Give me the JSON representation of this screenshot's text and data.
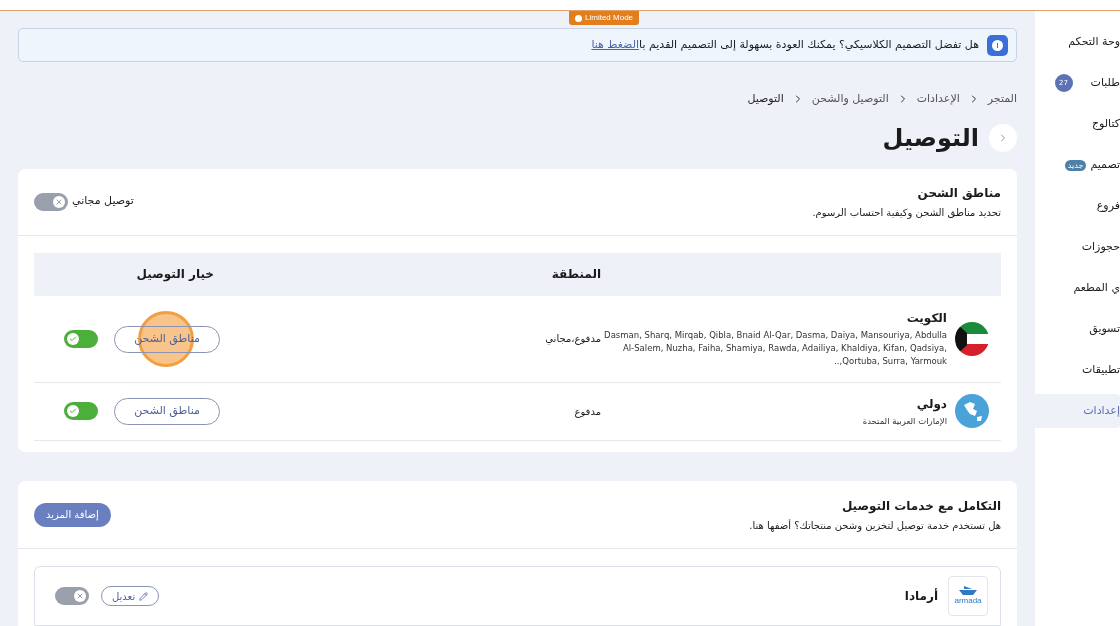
{
  "top_bar": {
    "mode_badge": "Limited Mode"
  },
  "banner": {
    "text": "هل تفضل التصميم الكلاسيكي؟ يمكنك العودة بسهولة إلى التصميم القديم با",
    "link": "الضغط هنا"
  },
  "breadcrumb": [
    "المتجر",
    "الإعدادات",
    "التوصيل والشحن",
    "التوصيل"
  ],
  "page_title": "التوصيل",
  "shipping_zones": {
    "title": "مناطق الشحن",
    "description": "تحديد مناطق الشحن وكيفية احتساب الرسوم.",
    "free_delivery": {
      "label": "توصيل مجاني",
      "on": false
    },
    "table": {
      "columns": [
        "المنطقة",
        "خيار التوصيل"
      ],
      "rows": [
        {
          "kind": "flag",
          "name": "الكويت",
          "areas": "Dasman, Sharq, Mirqab, Qibla, Bnaid Al-Qar, Dasma, Daiya, Mansouriya, Abdulla Al-Salem, Nuzha, Faiha, Shamiya, Rawda, Adailiya, Khaldiya, Kifan, Qadsiya, Qortuba, Surra, Yarmouk,..",
          "pricing": "مدفوع،مجاني",
          "button": "مناطق الشحن",
          "on": true
        },
        {
          "kind": "globe",
          "name": "دولي",
          "areas": "الإمارات العربية المتحدة",
          "pricing": "مدفوع",
          "button": "مناطق الشحن",
          "on": true
        }
      ]
    }
  },
  "integrations": {
    "title": "التكامل مع خدمات التوصيل",
    "description": "هل تستخدم خدمة توصيل لتخزين وشحن منتجاتك؟ أضفها هنا.",
    "add_button": "إضافة المزيد",
    "services": [
      {
        "name": "أرمادا",
        "logo_text": "armada",
        "edit": "تعديل",
        "on": false
      }
    ]
  },
  "sidebar": {
    "items": [
      {
        "label": "وحة التحكم",
        "selected": false
      },
      {
        "label": "طلبات",
        "selected": false,
        "badge": "27"
      },
      {
        "label": "كتالوج",
        "selected": false
      },
      {
        "label": "تصميم",
        "selected": false,
        "tag": "جديد"
      },
      {
        "label": "فروع",
        "selected": false
      },
      {
        "label": "حجوزات",
        "selected": false
      },
      {
        "label": "ي المطعم",
        "selected": false
      },
      {
        "label": "تسويق",
        "selected": false
      },
      {
        "label": "تطبيقات",
        "selected": false
      },
      {
        "label": "إعدادات",
        "selected": true
      }
    ]
  }
}
